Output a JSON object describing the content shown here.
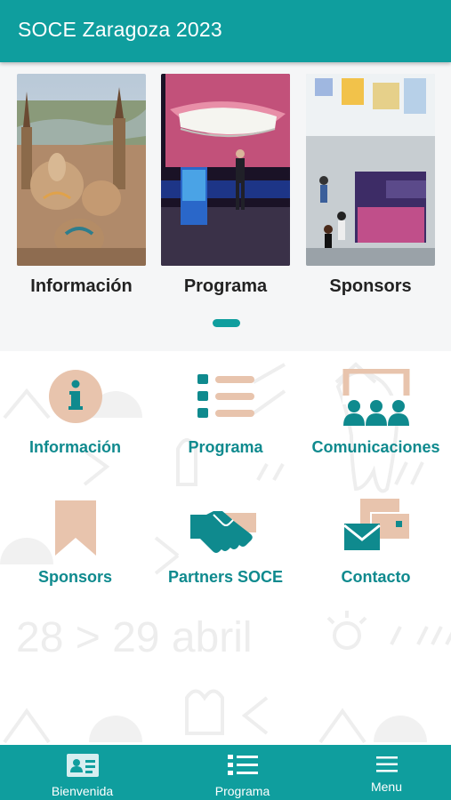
{
  "appbar": {
    "title": "SOCE Zaragoza 2023"
  },
  "carousel": {
    "cards": [
      {
        "label": "Información"
      },
      {
        "label": "Programa"
      },
      {
        "label": "Sponsors"
      }
    ]
  },
  "grid": {
    "background_text": "28 > 29 abril",
    "tiles": [
      {
        "label": "Información",
        "icon": "info-icon"
      },
      {
        "label": "Programa",
        "icon": "list-icon"
      },
      {
        "label": "Comunicaciones",
        "icon": "audience-icon"
      },
      {
        "label": "Sponsors",
        "icon": "bookmark-icon"
      },
      {
        "label": "Partners SOCE",
        "icon": "handshake-icon"
      },
      {
        "label": "Contacto",
        "icon": "mail-icon"
      }
    ]
  },
  "bottom_nav": {
    "tabs": [
      {
        "label": "Bienvenida",
        "icon": "id-card-icon"
      },
      {
        "label": "Programa",
        "icon": "list-icon"
      },
      {
        "label": "Menu",
        "icon": "hamburger-icon"
      }
    ]
  },
  "colors": {
    "primary": "#0f9e9e",
    "accent_peach": "#e8c4ad",
    "teal_dark": "#0f8a8e"
  }
}
